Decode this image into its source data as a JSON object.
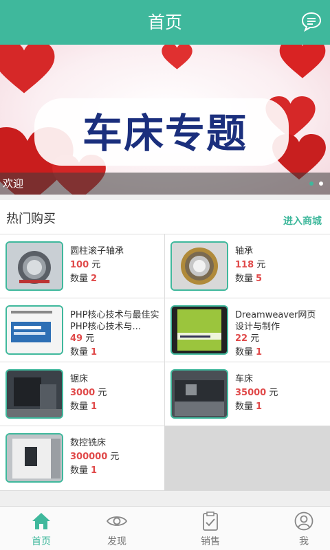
{
  "header": {
    "title": "首页",
    "message_icon": "chat-bubble-icon"
  },
  "banner": {
    "headline": "车床专题",
    "caption": "欢迎"
  },
  "section": {
    "title": "热门购买",
    "link": "进入商城"
  },
  "currency": "元",
  "qty_label": "数量",
  "products": [
    {
      "name": "圆柱滚子轴承",
      "price": "100",
      "qty": "2"
    },
    {
      "name": "轴承",
      "price": "118",
      "qty": "5"
    },
    {
      "name": "PHP核心技术与最佳实PHP核心技术与...",
      "price": "49",
      "qty": "1"
    },
    {
      "name": "Dreamweaver网页设计与制作",
      "price": "22",
      "qty": "1"
    },
    {
      "name": "锯床",
      "price": "3000",
      "qty": "1"
    },
    {
      "name": "车床",
      "price": "35000",
      "qty": "1"
    },
    {
      "name": "数控铣床",
      "price": "300000",
      "qty": "1"
    }
  ],
  "tabs": [
    {
      "label": "首页",
      "icon": "home-icon"
    },
    {
      "label": "发现",
      "icon": "eye-icon"
    },
    {
      "label": "销售",
      "icon": "clipboard-icon"
    },
    {
      "label": "我",
      "icon": "user-icon"
    }
  ],
  "colors": {
    "accent": "#3fb89c",
    "price": "#e04a4a"
  }
}
